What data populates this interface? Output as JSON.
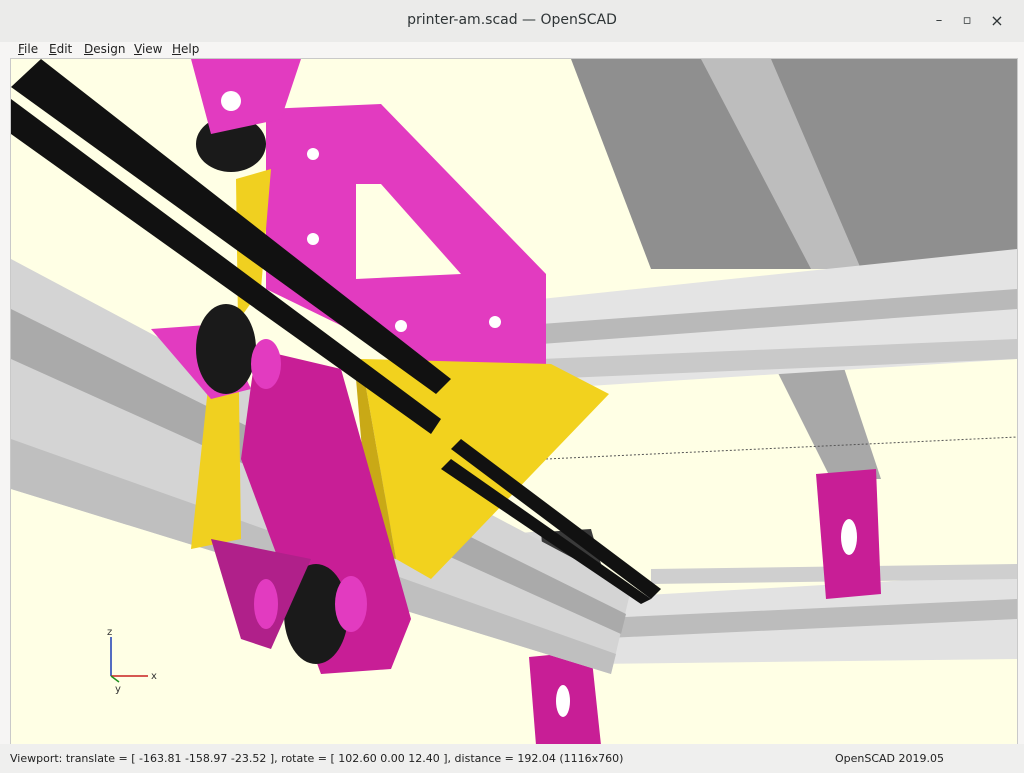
{
  "window": {
    "title": "printer-am.scad — OpenSCAD",
    "minimize_glyph": "–",
    "maximize_glyph": "▫",
    "close_glyph": "×"
  },
  "menu": {
    "items": [
      {
        "name": "File",
        "u": "F",
        "rest": "ile"
      },
      {
        "name": "Edit",
        "u": "E",
        "rest": "dit"
      },
      {
        "name": "Design",
        "u": "D",
        "rest": "esign"
      },
      {
        "name": "View",
        "u": "V",
        "rest": "iew"
      },
      {
        "name": "Help",
        "u": "H",
        "rest": "elp"
      }
    ]
  },
  "viewport": {
    "background": "#ffffe5",
    "axes": {
      "z": "z",
      "x": "x",
      "y": "y"
    },
    "colors": {
      "magenta": "#e040c0",
      "magenta_dark": "#b0208a",
      "yellow": "#f0d020",
      "yellow_dark": "#c8a818",
      "black": "#111111",
      "aluminium": "#d9d9d9",
      "aluminium_dark": "#9a9a9a"
    }
  },
  "status": {
    "viewport_text": "Viewport: translate = [ -163.81 -158.97 -23.52 ], rotate = [ 102.60 0.00 12.40 ], distance = 192.04 (1116x760)",
    "version": "OpenSCAD 2019.05"
  }
}
